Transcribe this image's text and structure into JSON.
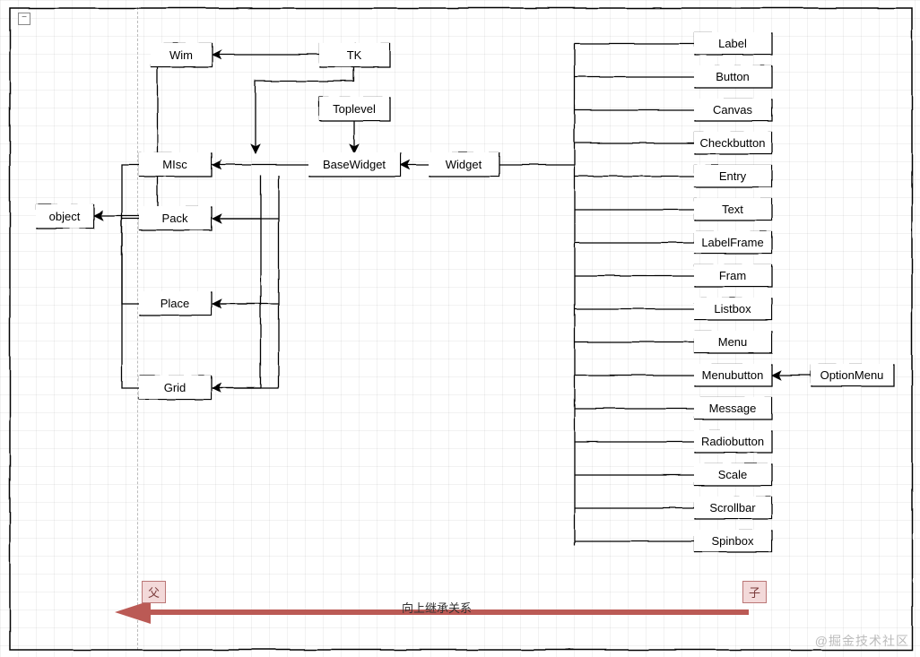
{
  "nodes": {
    "object": "object",
    "wim": "Wim",
    "tk": "TK",
    "toplevel": "Toplevel",
    "misc": "MIsc",
    "basewidget": "BaseWidget",
    "widget": "Widget",
    "pack": "Pack",
    "place": "Place",
    "grid": "Grid",
    "label": "Label",
    "button": "Button",
    "canvas_n": "Canvas",
    "checkbutton": "Checkbutton",
    "entry": "Entry",
    "text": "Text",
    "labelframe": "LabelFrame",
    "fram": "Fram",
    "listbox": "Listbox",
    "menu": "Menu",
    "menubutton": "Menubutton",
    "message": "Message",
    "radiobutton": "Radiobutton",
    "scale": "Scale",
    "scrollbar": "Scrollbar",
    "spinbox": "Spinbox",
    "optionmenu": "OptionMenu"
  },
  "tags": {
    "parent": "父",
    "child": "子"
  },
  "arrow_caption": "向上继承关系",
  "watermark": "@掘金技术社区",
  "collapse_glyph": "−"
}
